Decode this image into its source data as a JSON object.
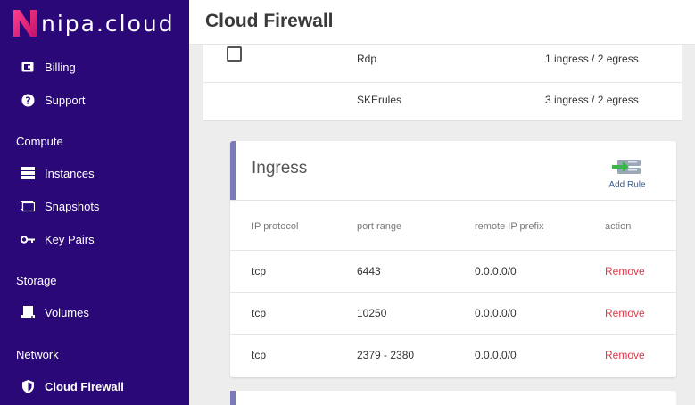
{
  "brand": {
    "name": "nipa.cloud"
  },
  "header": {
    "title": "Cloud Firewall"
  },
  "sidebar": {
    "items_top": [
      {
        "label": "Billing",
        "icon": "wallet-icon"
      },
      {
        "label": "Support",
        "icon": "question-icon"
      }
    ],
    "sections": [
      {
        "title": "Compute",
        "items": [
          {
            "label": "Instances",
            "icon": "server-icon"
          },
          {
            "label": "Snapshots",
            "icon": "monitor-icon"
          },
          {
            "label": "Key Pairs",
            "icon": "key-icon"
          }
        ]
      },
      {
        "title": "Storage",
        "items": [
          {
            "label": "Volumes",
            "icon": "drive-icon"
          }
        ]
      },
      {
        "title": "Network",
        "items": [
          {
            "label": "Cloud Firewall",
            "icon": "shield-icon",
            "active": true
          }
        ]
      }
    ]
  },
  "firewalls": [
    {
      "name": "Rdp",
      "rules": "1 ingress / 2 egress"
    },
    {
      "name": "SKErules",
      "rules": "3 ingress / 2 egress"
    }
  ],
  "ingress": {
    "title": "Ingress",
    "add_rule_label": "Add Rule",
    "columns": [
      "IP protocol",
      "port range",
      "remote IP prefix",
      "action"
    ],
    "rows": [
      {
        "protocol": "tcp",
        "port_range": "6443",
        "prefix": "0.0.0.0/0",
        "action": "Remove"
      },
      {
        "protocol": "tcp",
        "port_range": "10250",
        "prefix": "0.0.0.0/0",
        "action": "Remove"
      },
      {
        "protocol": "tcp",
        "port_range": "2379 - 2380",
        "prefix": "0.0.0.0/0",
        "action": "Remove"
      }
    ]
  },
  "colors": {
    "sidebar_bg": "#2a0878",
    "brand_accent": "#e8177a",
    "remove": "#e0394a",
    "card_accent": "#7a7ab5",
    "add_rule_green": "#3bb54a"
  }
}
